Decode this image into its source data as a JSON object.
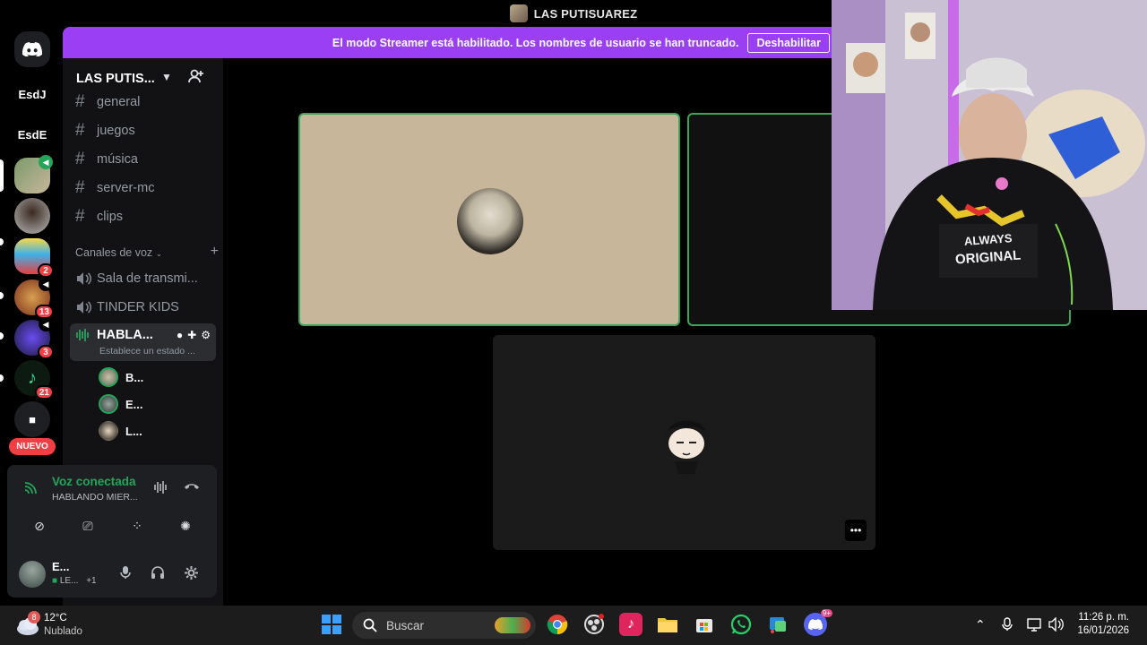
{
  "window": {
    "title": "LAS PUTISUAREZ"
  },
  "banner": {
    "message": "El modo Streamer está habilitado. Los nombres de usuario se han truncado.",
    "button": "Deshabilitar"
  },
  "rail": {
    "servers": [
      {
        "label": "EsdJ"
      },
      {
        "label": "EsdE"
      }
    ],
    "badges": [
      "2",
      "13",
      "3",
      "21"
    ],
    "new_label": "NUEVO"
  },
  "guild": {
    "name": "LAS PUTIS..."
  },
  "channels": {
    "text": [
      "general",
      "juegos",
      "música",
      "server-mc",
      "clips"
    ],
    "voice_category": "Canales de voz",
    "voice": [
      "Sala de transmi...",
      "TINDER KIDS"
    ],
    "active_voice": {
      "name": "HABLA...",
      "status": "Establece un estado ..."
    },
    "voice_users": [
      "B...",
      "E...",
      "L..."
    ]
  },
  "panel": {
    "voice_connected": "Voz conectada",
    "voice_channel": "HABLANDO MIER...",
    "user_name": "E...",
    "user_status": "LE...",
    "user_extra": "+1"
  },
  "taskbar": {
    "weather_badge": "8",
    "temperature": "12°C",
    "condition": "Nublado",
    "search_label": "Buscar",
    "discord_badge": "9+",
    "time": "11:26 p. m.",
    "date": "16/01/2026"
  },
  "colors": {
    "banner": "#9a3ff3",
    "speaking": "#3ba55c",
    "badge": "#f23f43",
    "sidebar": "#121214"
  }
}
